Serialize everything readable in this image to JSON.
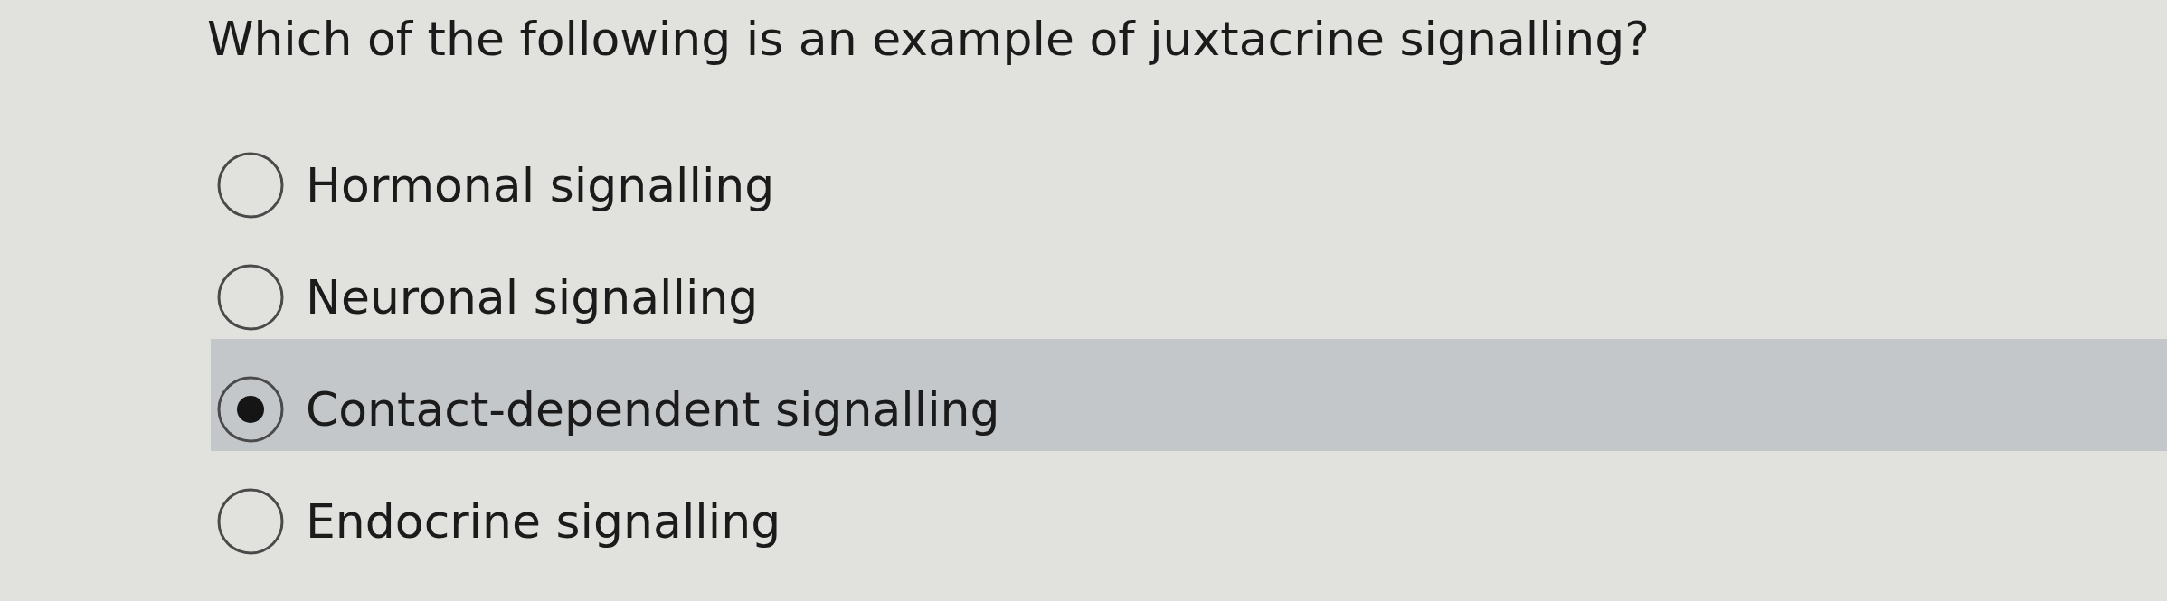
{
  "question": "Which of the following is an example of juxtacrine signalling?",
  "options": [
    {
      "label": "Hormonal signalling",
      "selected": false
    },
    {
      "label": "Neuronal signalling",
      "selected": false
    },
    {
      "label": "Contact-dependent signalling",
      "selected": true
    },
    {
      "label": "Endocrine signalling",
      "selected": false
    }
  ]
}
